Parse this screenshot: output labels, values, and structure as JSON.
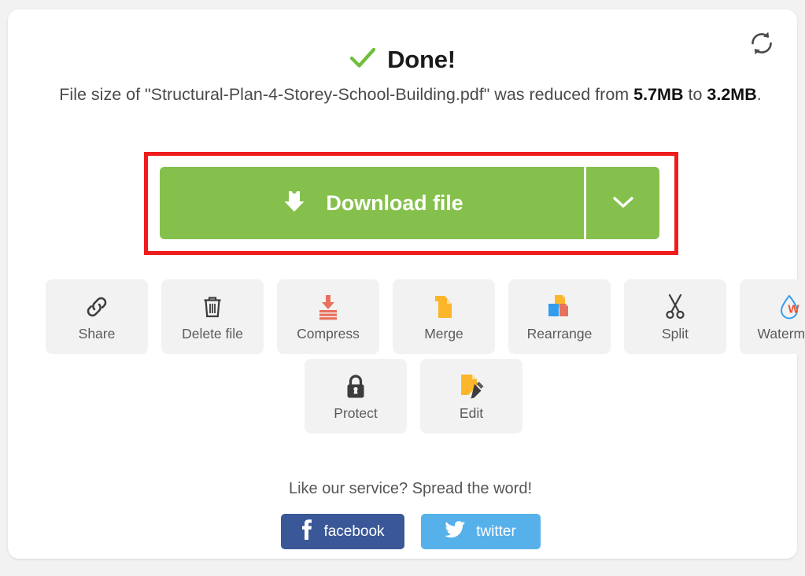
{
  "header": {
    "refresh_icon": "refresh-icon",
    "check_icon": "check-icon",
    "status_title": "Done!",
    "status_color": "#6fbf3c"
  },
  "description": {
    "prefix": "File size of \"",
    "filename": "Structural-Plan-4-Storey-School-Building.pdf",
    "middle": "\" was reduced from ",
    "original_size": "5.7MB",
    "joiner": " to ",
    "new_size": "3.2MB",
    "suffix": "."
  },
  "download": {
    "label": "Download file",
    "download_icon": "download-icon",
    "caret_icon": "chevron-down-icon",
    "button_color": "#85c04c",
    "highlight_color": "#ef1c1c"
  },
  "tools": {
    "row1": [
      {
        "label": "Share",
        "icon": "link-icon"
      },
      {
        "label": "Delete file",
        "icon": "trash-icon"
      },
      {
        "label": "Compress",
        "icon": "compress-icon"
      },
      {
        "label": "Merge",
        "icon": "merge-pages-icon"
      },
      {
        "label": "Rearrange",
        "icon": "rearrange-pages-icon"
      },
      {
        "label": "Split",
        "icon": "scissors-icon"
      },
      {
        "label": "Watermark",
        "icon": "watermark-droplet-icon"
      }
    ],
    "row2": [
      {
        "label": "Protect",
        "icon": "lock-icon"
      },
      {
        "label": "Edit",
        "icon": "edit-document-icon"
      }
    ]
  },
  "social": {
    "prompt": "Like our service? Spread the word!",
    "facebook_label": "facebook",
    "facebook_icon": "facebook-icon",
    "facebook_color": "#3a5897",
    "twitter_label": "twitter",
    "twitter_icon": "twitter-icon",
    "twitter_color": "#56b0ea"
  }
}
